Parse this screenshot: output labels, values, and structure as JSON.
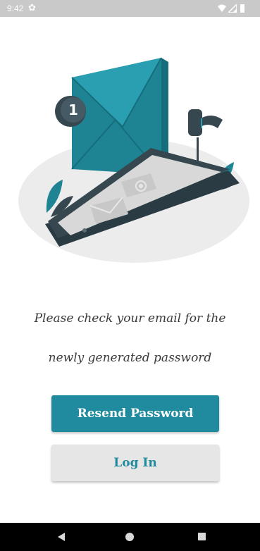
{
  "status_bar": {
    "time": "9:42",
    "icons": [
      "settings-icon",
      "wifi-icon",
      "signal-icon",
      "battery-icon"
    ]
  },
  "illustration": {
    "description_icon": "email-notification-illustration",
    "badge_count": "1",
    "colors": {
      "accent": "#208a9e",
      "dark": "#37474f",
      "blob": "#ececec"
    }
  },
  "message": {
    "line1": "Please check your email for the",
    "line2": "newly generated password"
  },
  "buttons": {
    "resend_label": "Resend Password",
    "login_label": "Log In"
  },
  "colors": {
    "primary": "#208a9e",
    "secondary_bg": "#e6e6e6"
  },
  "nav_bar": {
    "icons": [
      "back-icon",
      "home-icon",
      "recents-icon"
    ]
  }
}
